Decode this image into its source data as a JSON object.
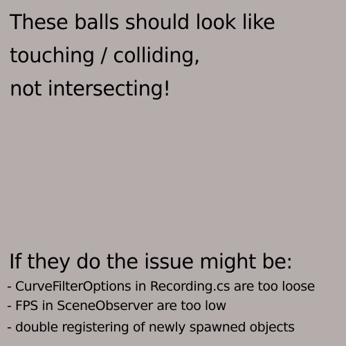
{
  "page": {
    "background_color": "#b5adab",
    "text_color": "#000000"
  },
  "heading": {
    "lines": [
      "These balls should look like",
      "touching / colliding,",
      "not intersecting!"
    ]
  },
  "issues": {
    "title": "If they do the issue might be:",
    "items": [
      "- CurveFilterOptions in Recording.cs are too loose",
      "- FPS in SceneObserver are too low",
      "- double registering of newly spawned objects"
    ]
  }
}
